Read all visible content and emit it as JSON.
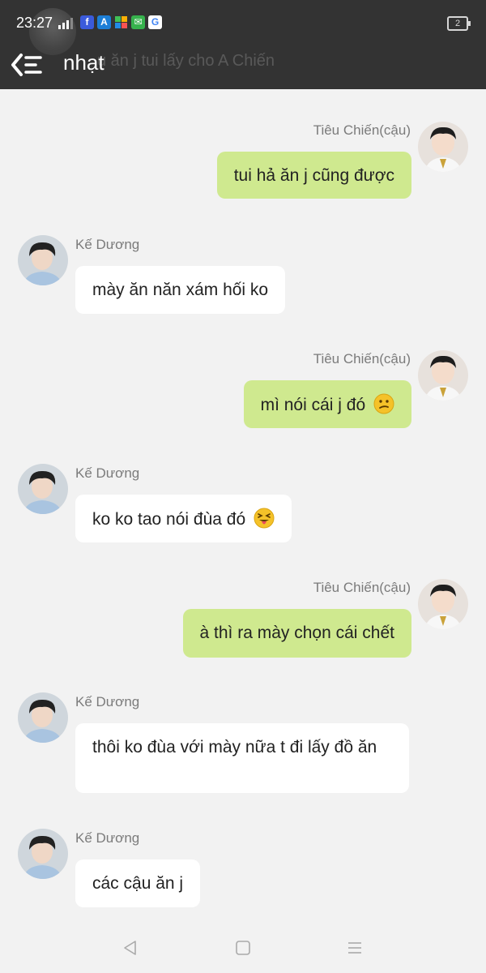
{
  "status_bar": {
    "time": "23:27",
    "battery": "2",
    "notification_icons": [
      "facebook-icon",
      "accessibility-icon",
      "puzzle-icon",
      "chat-app-icon",
      "google-icon"
    ]
  },
  "header": {
    "title": "nhạt",
    "behind_text": "u ăn j tui lấy cho A Chiến"
  },
  "messages": [
    {
      "side": "right",
      "sender": "Tiêu Chiến(cậu)",
      "text": "tui hả ăn j cũng được",
      "emoji": ""
    },
    {
      "side": "left",
      "sender": "Kế Dương",
      "text": "mày ăn năn xám hối ko",
      "emoji": ""
    },
    {
      "side": "right",
      "sender": "Tiêu Chiến(cậu)",
      "text": "mì nói cái j đó",
      "emoji": "confused-face-emoji"
    },
    {
      "side": "left",
      "sender": "Kế Dương",
      "text": "ko ko tao nói đùa đó",
      "emoji": "tongue-out-face-emoji"
    },
    {
      "side": "right",
      "sender": "Tiêu Chiến(cậu)",
      "text": "à thì ra mày chọn cái chết",
      "emoji": ""
    },
    {
      "side": "left",
      "sender": "Kế Dương",
      "text": "thôi ko đùa với mày nữa t đi lấy đồ ăn",
      "emoji": ""
    },
    {
      "side": "left",
      "sender": "Kế Dương",
      "text": "các cậu ăn j",
      "emoji": ""
    }
  ],
  "nav": [
    "back-triangle-icon",
    "home-square-icon",
    "menu-lines-icon"
  ]
}
